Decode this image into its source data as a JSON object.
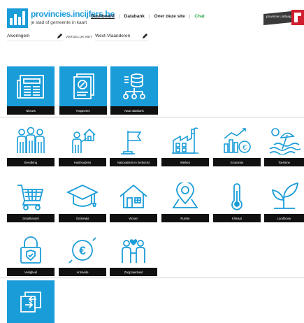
{
  "header": {
    "logo_title": "provincies.incijfers.be",
    "logo_subtitle": "je stad of gemeente in kaart",
    "nav": [
      {
        "label": "Dashboard",
        "active": true
      },
      {
        "label": "Databank",
        "active": false
      },
      {
        "label": "Over deze site",
        "active": false
      },
      {
        "label": "Chat",
        "active": false
      }
    ],
    "partner_text": "provincie Limburg"
  },
  "filters": {
    "municipality": "Alveringem",
    "compare_label": "VERGELIJK MET",
    "compare_value": "West-Vlaanderen"
  },
  "top_tiles": [
    {
      "label": "Nieuws",
      "icon": "newspaper-icon"
    },
    {
      "label": "Rapporten",
      "icon": "report-icon"
    },
    {
      "label": "Naar databank",
      "icon": "database-icon"
    }
  ],
  "themes": [
    {
      "label": "Bevolking",
      "icon": "people-icon"
    },
    {
      "label": "Huishoudens",
      "icon": "household-icon"
    },
    {
      "label": "Nationaliteit en herkomst",
      "icon": "flag-icon"
    },
    {
      "label": "Werken",
      "icon": "factory-icon"
    },
    {
      "label": "Economie",
      "icon": "economy-icon"
    },
    {
      "label": "Toerisme",
      "icon": "beach-icon"
    },
    {
      "label": "Detailhandel",
      "icon": "cart-icon"
    },
    {
      "label": "Onderwijs",
      "icon": "graduation-cap-icon"
    },
    {
      "label": "Wonen",
      "icon": "house-icon"
    },
    {
      "label": "Ruimte",
      "icon": "map-pin-icon"
    },
    {
      "label": "Klimaat",
      "icon": "thermometer-icon"
    },
    {
      "label": "Landbouw",
      "icon": "plant-icon"
    },
    {
      "label": "Veiligheid",
      "icon": "lock-icon"
    },
    {
      "label": "Armoede",
      "icon": "euro-coin-icon"
    },
    {
      "label": "Zorgzaamheid",
      "icon": "care-icon"
    }
  ],
  "bottom_tile": {
    "icon": "switch-icon"
  },
  "colors": {
    "accent": "#1a9cd8",
    "label_bg": "#111111",
    "chat": "#2aa84a",
    "limburg_red": "#d0202f"
  }
}
